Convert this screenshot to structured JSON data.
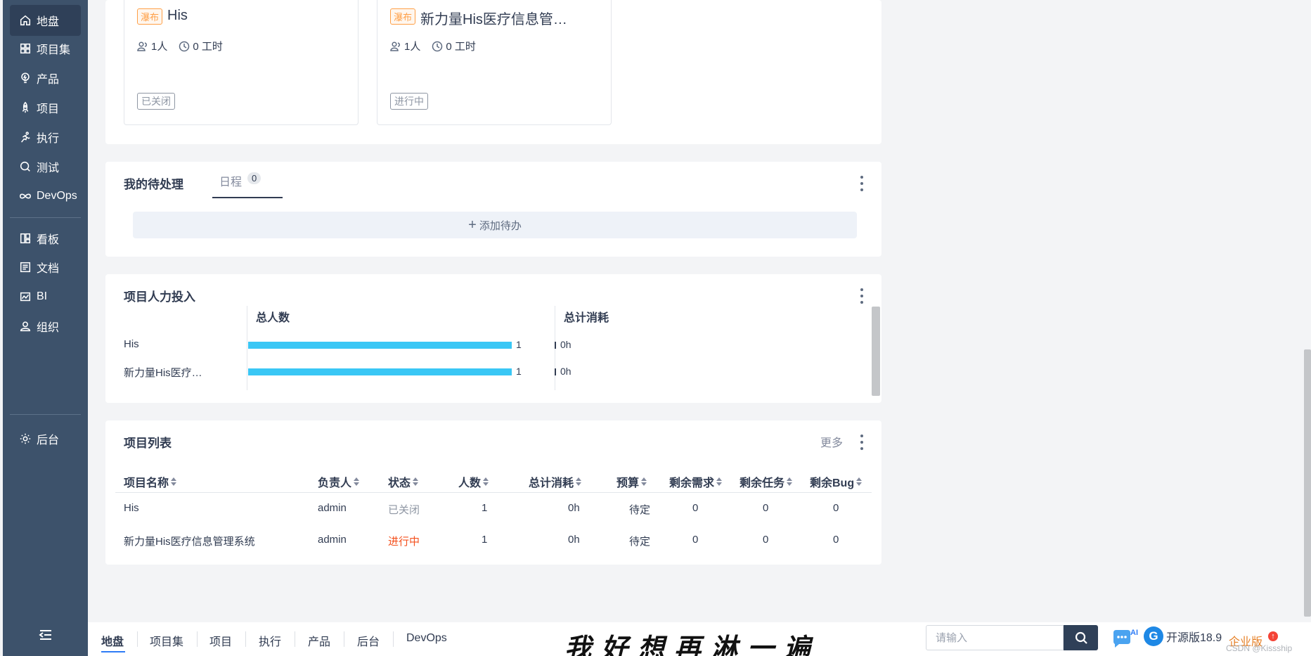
{
  "sidebar": {
    "items": [
      {
        "label": "地盘",
        "icon": "home-icon",
        "active": true
      },
      {
        "label": "项目集",
        "icon": "grid-icon"
      },
      {
        "label": "产品",
        "icon": "lightbulb-icon"
      },
      {
        "label": "项目",
        "icon": "rocket-icon"
      },
      {
        "label": "执行",
        "icon": "run-icon"
      },
      {
        "label": "测试",
        "icon": "bug-search-icon"
      },
      {
        "label": "DevOps",
        "icon": "infinity-icon"
      },
      {
        "label": "看板",
        "icon": "kanban-icon"
      },
      {
        "label": "文档",
        "icon": "doc-icon"
      },
      {
        "label": "BI",
        "icon": "chart-icon"
      },
      {
        "label": "组织",
        "icon": "users-icon"
      },
      {
        "label": "后台",
        "icon": "gear-icon"
      }
    ]
  },
  "cards": [
    {
      "tag": "瀑布",
      "name": "His",
      "members": "1人",
      "hours": "0 工时",
      "status": "已关闭"
    },
    {
      "tag": "瀑布",
      "name": "新力量His医疗信息管…",
      "members": "1人",
      "hours": "0 工时",
      "status": "进行中"
    }
  ],
  "todo": {
    "title": "我的待处理",
    "tab_label": "日程",
    "tab_count": "0",
    "add_label": "添加待办"
  },
  "manpower": {
    "title": "项目人力投入",
    "col_people": "总人数",
    "col_cost": "总计消耗",
    "rows": [
      {
        "name": "His",
        "people": "1",
        "cost": "0h"
      },
      {
        "name": "新力量His医疗…",
        "people": "1",
        "cost": "0h"
      }
    ]
  },
  "project_list": {
    "title": "项目列表",
    "more": "更多",
    "headers": [
      "项目名称",
      "负责人",
      "状态",
      "人数",
      "总计消耗",
      "预算",
      "剩余需求",
      "剩余任务",
      "剩余Bug"
    ],
    "rows": [
      {
        "name": "His",
        "owner": "admin",
        "status": "已关闭",
        "people": "1",
        "cost": "0h",
        "budget": "待定",
        "stories": "0",
        "tasks": "0",
        "bugs": "0"
      },
      {
        "name": "新力量His医疗信息管理系统",
        "owner": "admin",
        "status": "进行中",
        "people": "1",
        "cost": "0h",
        "budget": "待定",
        "stories": "0",
        "tasks": "0",
        "bugs": "0"
      }
    ]
  },
  "bottombar": {
    "nav": [
      "地盘",
      "项目集",
      "项目",
      "执行",
      "产品",
      "后台",
      "DevOps"
    ],
    "slogan": "我好想再淋一遍",
    "search_placeholder": "请输入",
    "ai_label": "AI",
    "version": "开源版18.9",
    "enterprise": "企业版",
    "watermark": "CSDN @Kissship"
  },
  "colors": {
    "sidebar_bg": "#3d526b",
    "accent_bar": "#3ac7f5",
    "status_active": "#f4511e",
    "status_closed": "#8e96a3",
    "tag_waterfall": "#ff9f46"
  }
}
